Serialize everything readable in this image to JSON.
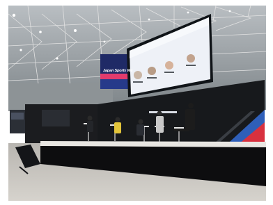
{
  "scene": {
    "description_free": true,
    "banner": {
      "title": "Japan Sports We",
      "colors": {
        "background": "#1f2a66",
        "accent": "#e23b6d"
      }
    },
    "screen": {
      "heading": "",
      "speaker_count": 4,
      "colors": {
        "face": "#eef1f7",
        "title": "#3d63a8",
        "bezel": "#101418"
      }
    },
    "backdrop": {
      "title": "",
      "colors": {
        "dark": "#17191c",
        "stripe_red": "#d8313f",
        "stripe_blue": "#2f5fb9"
      }
    },
    "stage": {
      "panelist_count": 5,
      "colors": {
        "floor": "#c9c6c0",
        "stage_front": "#0d0d0f"
      }
    },
    "venue": {
      "colors": {
        "truss": "#dcdcdc",
        "ceiling": "#9aa0a4"
      }
    }
  }
}
